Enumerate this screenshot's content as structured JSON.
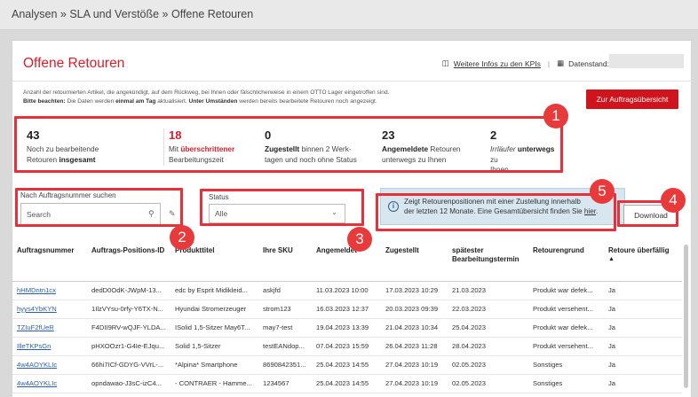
{
  "breadcrumb": "Analysen » SLA und Verstöße » Offene Retouren",
  "page_title": "Offene Retouren",
  "kpi_link": "Weitere Infos zu den KPIs",
  "datestand_label": "Datenstand:",
  "description": {
    "line1": "Anzahl der retournierten Artikel, die angekündigt, auf dem Rückweg, bei Ihnen oder fälschlicherweise in einem OTTO Lager eingetroffen sind.",
    "note_label": "Bitte beachten:",
    "note_text1": " Die Daten werden ",
    "note_bold1": "einmal am Tag",
    "note_text2": " aktualisiert. ",
    "note_bold2": "Unter Umständen",
    "note_text3": " werden bereits bearbeitete Retouren noch angezeigt."
  },
  "order_overview_button": "Zur Auftragsübersicht",
  "kpis": [
    {
      "value": "43",
      "l1": "Noch zu bearbeitende",
      "l2a": "Retouren ",
      "l2b": "insgesamt"
    },
    {
      "value": "18",
      "l1a": "Mit ",
      "l1b": "überschrittener",
      "l2": "Bearbeitungszeit"
    },
    {
      "value": "0",
      "l1a": "Zugestellt",
      "l1b": " binnen 2 Werk-",
      "l2": "tagen und noch ohne Status"
    },
    {
      "value": "23",
      "l1a": "Angemeldete",
      "l1b": " Retouren",
      "l2": "unterwegs zu Ihnen"
    },
    {
      "value": "2",
      "l1a": "Irrläufer",
      "l1b": " unterwegs",
      "l1c": " zu",
      "l2": "Ihnen"
    }
  ],
  "search": {
    "label": "Nach Auftragsnummer suchen",
    "placeholder": "Search"
  },
  "status": {
    "label": "Status",
    "value": "Alle"
  },
  "info_text": {
    "line1": "Zeigt Retourenpositionen mit einer Zustellung innerhalb",
    "line2": "der letzten 12 Monate. Eine Gesamtübersicht finden Sie ",
    "link": "hier",
    "end": "."
  },
  "download_button": "Download",
  "badges": [
    "1",
    "2",
    "3",
    "4",
    "5"
  ],
  "table": {
    "headers": [
      "Auftragsnummer",
      "Auftrags-Positions-ID",
      "Produkttitel",
      "Ihre SKU",
      "Angemeldet",
      "Zugestellt",
      "spätester Bearbeitungstermin",
      "Retourengrund",
      "Retoure überfällig"
    ],
    "rows": [
      [
        "hHMDntn1cx",
        "dedD0OdK-JWpM-13...",
        "edc by Esprit Midikleid...",
        "askjfd",
        "11.03.2023 10:00",
        "17.03.2023 10:29",
        "21.03.2023",
        "Produkt war defek...",
        "Ja"
      ],
      [
        "hyys4YbKYN",
        "1IlzVYsu-0rfy-Y6TX-N...",
        "Hyundai Stromerzeuger",
        "strom123",
        "16.03.2023 12:37",
        "20.03.2023 09:39",
        "22.03.2023",
        "Produkt versehent...",
        "Ja"
      ],
      [
        "TZIuF2fUeR",
        "F4DII9RV-wQJF-YLDA...",
        "ISolid 1,5-Sitzer May6T...",
        "may7-test",
        "19.04.2023 13:39",
        "21.04.2023 10:34",
        "25.04.2023",
        "Produkt war defek...",
        "Ja"
      ],
      [
        "IlleTKPsGn",
        "pHXOOzr1-G4Ie-EJqu...",
        "Solid 1,5-Sitzer",
        "testEANdop...",
        "07.04.2023 15:59",
        "26.04.2023 11:28",
        "28.04.2023",
        "Produkt versehent...",
        "Ja"
      ],
      [
        "4w4AOYKLIc",
        "66hi7ICf-GDYG-VVrL-...",
        "*Alpina* Smartphone",
        "8690842351...",
        "25.04.2023 14:55",
        "27.04.2023 10:19",
        "02.05.2023",
        "Sonstiges",
        "Ja"
      ],
      [
        "4w4AOYKLIc",
        "opndawao-J3sC-izC4...",
        "- CONTRAER - Hamme...",
        "1234567",
        "25.04.2023 14:55",
        "27.04.2023 10:19",
        "02.05.2023",
        "Sonstiges",
        "Ja"
      ]
    ]
  },
  "colors": {
    "accent": "#d91e2a",
    "annotation": "#e8303a",
    "info_bg": "#d7e6ef"
  }
}
